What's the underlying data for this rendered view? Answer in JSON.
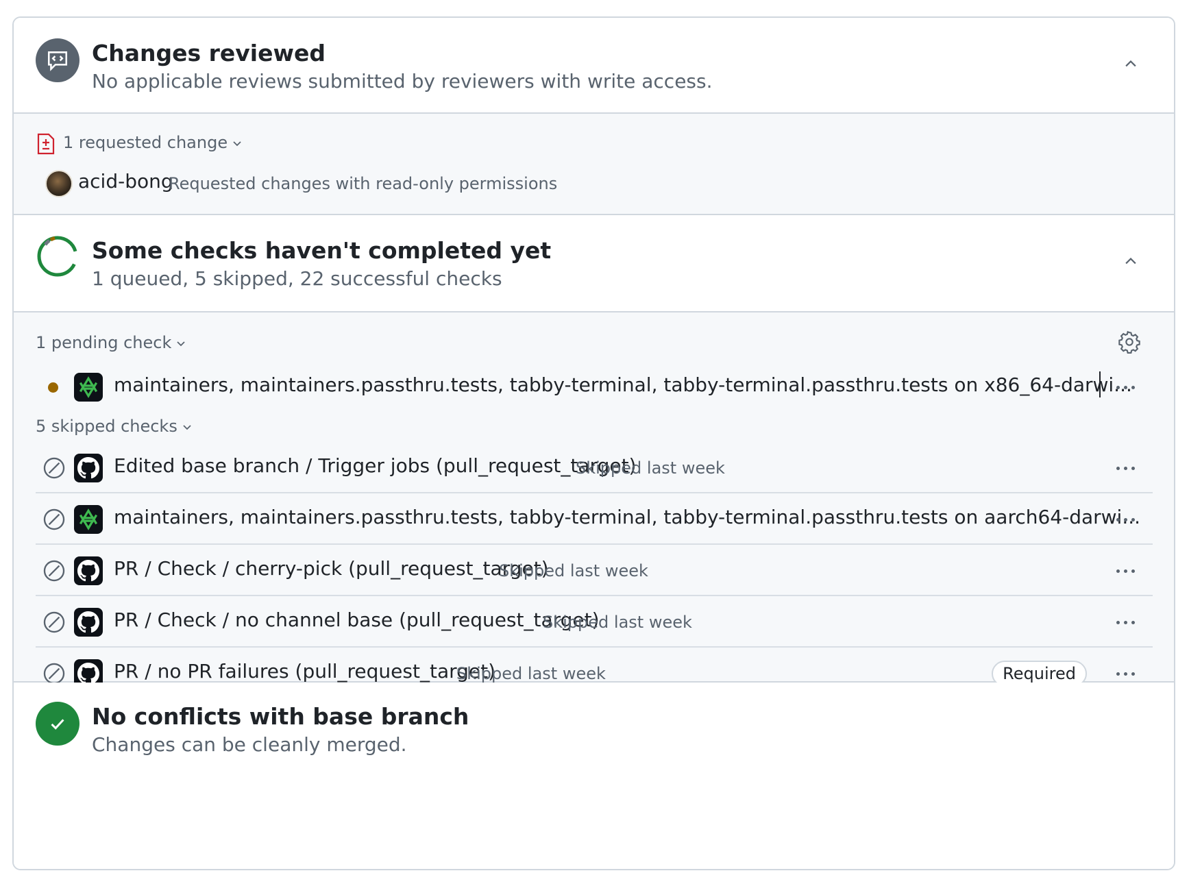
{
  "reviews": {
    "title": "Changes reviewed",
    "subtitle": "No applicable reviews submitted by reviewers with write access.",
    "requested_changes_label": "1 requested change",
    "reviewer": {
      "username": "acid-bong",
      "note": "Requested changes with read-only permissions"
    }
  },
  "checks": {
    "title": "Some checks haven't completed yet",
    "subtitle": "1 queued, 5 skipped, 22 successful checks",
    "pending_label": "1 pending check",
    "pending": [
      {
        "name": "maintainers, maintainers.passthru.tests, tabby-terminal, tabby-terminal.passthru.tests on x86_64-darwi...",
        "status": "queued",
        "app": "nix-icon"
      }
    ],
    "skipped_label": "5 skipped checks",
    "skipped": [
      {
        "name": "Edited base branch / Trigger jobs (pull_request_target)",
        "meta": "Skipped last week",
        "app": "github-icon",
        "required": ""
      },
      {
        "name": "maintainers, maintainers.passthru.tests, tabby-terminal, tabby-terminal.passthru.tests on aarch64-darwi...",
        "meta": "",
        "app": "nix-icon",
        "required": ""
      },
      {
        "name": "PR / Check / cherry-pick (pull_request_target)",
        "meta": "Skipped last week",
        "app": "github-icon",
        "required": ""
      },
      {
        "name": "PR / Check / no channel base (pull_request_target)",
        "meta": "Skipped last week",
        "app": "github-icon",
        "required": ""
      },
      {
        "name": "PR / no PR failures (pull_request_target)",
        "meta": "Skipped last week",
        "app": "github-icon",
        "required": "Required"
      }
    ]
  },
  "conflicts": {
    "title": "No conflicts with base branch",
    "subtitle": "Changes can be cleanly merged."
  },
  "colors": {
    "success": "#1f883d",
    "danger": "#cf222e",
    "pending": "#9a6700",
    "muted": "#59636e",
    "border": "#d0d7de"
  }
}
